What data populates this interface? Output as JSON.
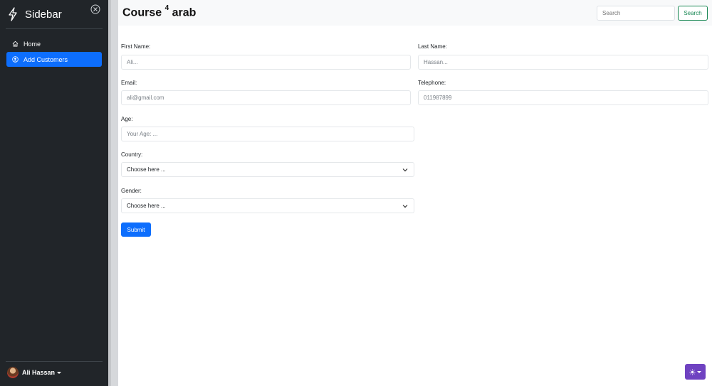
{
  "sidebar": {
    "title": "Sidebar",
    "items": [
      {
        "label": "Home",
        "icon": "house-icon",
        "active": false
      },
      {
        "label": "Add Customers",
        "icon": "person-circle-icon",
        "active": true
      }
    ],
    "user": {
      "name": "Ali Hassan"
    }
  },
  "header": {
    "title": "Course",
    "title_sup": "4",
    "title_suffix": "arab",
    "search_placeholder": "Search",
    "search_button": "Search"
  },
  "form": {
    "first_name": {
      "label": "First Name:",
      "placeholder": "Ali..."
    },
    "last_name": {
      "label": "Last Name:",
      "placeholder": "Hassan..."
    },
    "email": {
      "label": "Email:",
      "placeholder": "ali@gmail.com"
    },
    "telephone": {
      "label": "Telephone:",
      "placeholder": "011987899"
    },
    "age": {
      "label": "Age:",
      "placeholder": "Your Age: ..."
    },
    "country": {
      "label": "Country:",
      "value": "Choose here ..."
    },
    "gender": {
      "label": "Gender:",
      "value": "Choose here ..."
    },
    "submit": "Submit"
  },
  "colors": {
    "sidebar_bg": "#212529",
    "primary": "#0d6efd",
    "success": "#198754",
    "theme_toggle": "#6f42c1"
  }
}
